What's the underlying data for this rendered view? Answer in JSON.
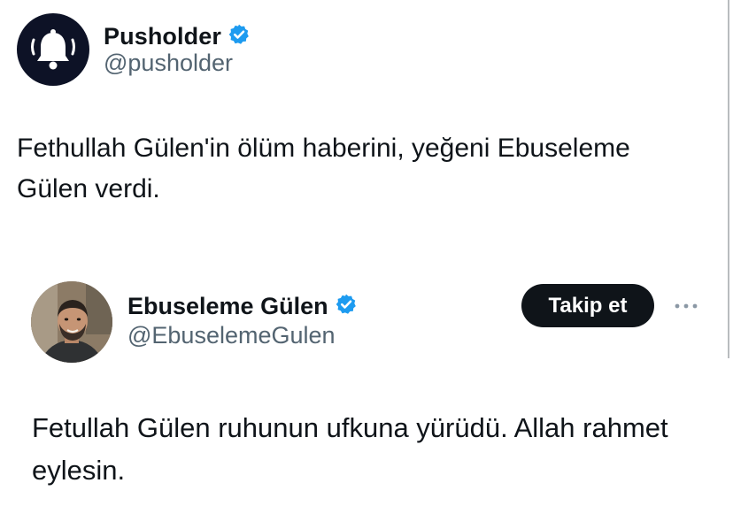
{
  "outer_tweet": {
    "author": {
      "name": "Pusholder",
      "handle": "@pusholder",
      "verified": true,
      "avatar_icon": "bell-icon"
    },
    "text": "Fethullah Gülen'in ölüm haberini, yeğeni Ebuseleme Gülen verdi."
  },
  "embedded_tweet": {
    "author": {
      "name": "Ebuseleme Gülen",
      "handle": "@EbuselemeGulen",
      "verified": true
    },
    "follow_label": "Takip et",
    "more_icon": "more-horizontal-icon",
    "text": "Fetullah Gülen ruhunun ufkuna yürüdü.  Allah rahmet eylesin."
  },
  "colors": {
    "verified_blue": "#1d9bf0",
    "text_primary": "#0f1419",
    "text_secondary": "#536471",
    "follow_button_bg": "#0f1419"
  }
}
